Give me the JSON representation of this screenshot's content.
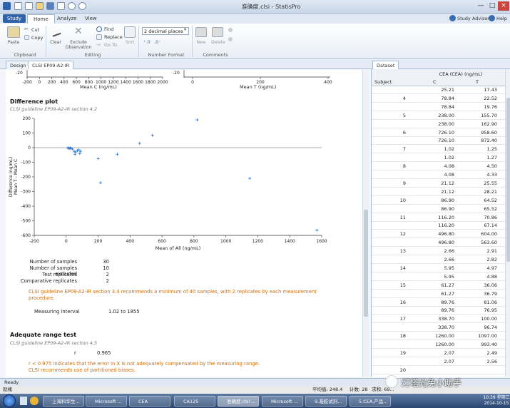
{
  "window": {
    "title": "准确度.clsi - StatisPro"
  },
  "menu": {
    "study": "Study",
    "tabs": [
      "Home",
      "Analyze",
      "View"
    ],
    "right": [
      "Study Advisor",
      "Help"
    ]
  },
  "ribbon": {
    "clipboard": {
      "paste": "Paste",
      "cut": "Cut",
      "copy": "Copy",
      "label": "Clipboard"
    },
    "editing": {
      "clear": "Clear",
      "exclude": "Exclude\nObservation",
      "find": "Find",
      "replace": "Replace",
      "goto": "Go To",
      "sort": "Sort",
      "label": "Editing"
    },
    "number_format": {
      "select": "2 decimal places",
      "label": "Number Format"
    },
    "comments": {
      "new": "New",
      "delete": "Delete",
      "label": "Comments"
    }
  },
  "doc_tabs": [
    "Design",
    "CLSI EP09-A2-IR"
  ],
  "dataset_tab": "Dataset",
  "top_axes": {
    "left": {
      "ticks": [
        "-200",
        "0",
        "200",
        "400",
        "600",
        "800",
        "1000",
        "1200",
        "1400",
        "1600",
        "1800",
        "2000"
      ],
      "xlabel": "Mean C (ng/mL)",
      "ytick": "-20"
    },
    "right": {
      "ticks": [
        "0",
        "200",
        "400"
      ],
      "xlabel": "Mean T (ng/mL)",
      "ytick": "-20"
    }
  },
  "difference_plot": {
    "title": "Difference plot",
    "subtitle": "CLSI guideline EP09-A2-IR section 4.2"
  },
  "chart_data": {
    "type": "scatter",
    "xlabel": "Mean of All (ng/mL)",
    "ylabel": "Difference (ng/mL)\nMean T - Mean C",
    "xlim": [
      -200,
      1600
    ],
    "ylim": [
      -600,
      200
    ],
    "xticks": [
      "-200",
      "0",
      "200",
      "400",
      "600",
      "800",
      "1000",
      "1200",
      "1400",
      "1600"
    ],
    "yticks": [
      "200",
      "100",
      "0",
      "-100",
      "-200",
      "-300",
      "-400",
      "-500",
      "-600"
    ],
    "points": [
      [
        10,
        -2
      ],
      [
        15,
        -3
      ],
      [
        20,
        -5
      ],
      [
        25,
        -2
      ],
      [
        30,
        -4
      ],
      [
        40,
        -10
      ],
      [
        50,
        -25
      ],
      [
        55,
        -45
      ],
      [
        60,
        -30
      ],
      [
        70,
        -20
      ],
      [
        80,
        -15
      ],
      [
        85,
        -40
      ],
      [
        90,
        -25
      ],
      [
        200,
        -75
      ],
      [
        215,
        -240
      ],
      [
        320,
        -45
      ],
      [
        460,
        30
      ],
      [
        540,
        85
      ],
      [
        820,
        190
      ],
      [
        1150,
        -210
      ],
      [
        1570,
        -565
      ]
    ]
  },
  "summary": {
    "rows": [
      {
        "label": "Number of samples",
        "value": "30"
      },
      {
        "label": "Number of samples excluded",
        "value": "10"
      },
      {
        "label": "Test replicates",
        "value": "2"
      },
      {
        "label": "Comparative replicates",
        "value": "2"
      }
    ],
    "warning": "CLSI guideline EP09-A2-IR section 3.4 recommends a minimum of 40 samples, with 2 replicates by each measurement procedure.",
    "interval_label": "Measuring interval",
    "interval_value": "1.02 to 1855"
  },
  "adequate": {
    "title": "Adequate range test",
    "subtitle": "CLSI guideline EP09-A2-IR section 4.5",
    "r_label": "r",
    "r_value": "0.965",
    "note1": "r < 0.975 indicates that the error in X is not adequately compensated by the measuring range.",
    "note2": "CLSI recommends use of partitioned biases."
  },
  "dataset": {
    "header": "CEA (CEA) (ng/mL)",
    "col_subject": "Subject",
    "col_c": "C",
    "col_t": "T",
    "rows": [
      {
        "s": "",
        "c": "25.21",
        "t": "17.43"
      },
      {
        "s": "4",
        "c": "78.84",
        "t": "22.52"
      },
      {
        "s": "",
        "c": "78.84",
        "t": "19.76"
      },
      {
        "s": "5",
        "c": "238.00",
        "t": "155.70"
      },
      {
        "s": "",
        "c": "238.00",
        "t": "162.90"
      },
      {
        "s": "6",
        "c": "726.10",
        "t": "958.60"
      },
      {
        "s": "",
        "c": "726.10",
        "t": "872.40"
      },
      {
        "s": "7",
        "c": "1.02",
        "t": "1.25"
      },
      {
        "s": "",
        "c": "1.02",
        "t": "1.27"
      },
      {
        "s": "8",
        "c": "4.08",
        "t": "4.50"
      },
      {
        "s": "",
        "c": "4.08",
        "t": "4.33"
      },
      {
        "s": "9",
        "c": "21.12",
        "t": "25.55"
      },
      {
        "s": "",
        "c": "21.12",
        "t": "28.21"
      },
      {
        "s": "10",
        "c": "86.90",
        "t": "64.52"
      },
      {
        "s": "",
        "c": "86.90",
        "t": "65.52"
      },
      {
        "s": "11",
        "c": "116.20",
        "t": "70.86"
      },
      {
        "s": "",
        "c": "116.20",
        "t": "67.14"
      },
      {
        "s": "12",
        "c": "496.80",
        "t": "604.00"
      },
      {
        "s": "",
        "c": "496.80",
        "t": "563.60"
      },
      {
        "s": "13",
        "c": "2.66",
        "t": "2.91"
      },
      {
        "s": "",
        "c": "2.66",
        "t": "2.82"
      },
      {
        "s": "14",
        "c": "5.95",
        "t": "4.97"
      },
      {
        "s": "",
        "c": "5.95",
        "t": "4.88"
      },
      {
        "s": "15",
        "c": "61.27",
        "t": "36.06"
      },
      {
        "s": "",
        "c": "61.27",
        "t": "36.79"
      },
      {
        "s": "16",
        "c": "89.76",
        "t": "81.06"
      },
      {
        "s": "",
        "c": "89.76",
        "t": "76.95"
      },
      {
        "s": "17",
        "c": "338.70",
        "t": "100.00"
      },
      {
        "s": "",
        "c": "338.70",
        "t": "96.74"
      },
      {
        "s": "18",
        "c": "1260.00",
        "t": "1097.00"
      },
      {
        "s": "",
        "c": "1260.00",
        "t": "993.40"
      },
      {
        "s": "19",
        "c": "2.07",
        "t": "2.49"
      },
      {
        "s": "",
        "c": "2.07",
        "t": "2.56"
      },
      {
        "s": "20",
        "c": "",
        "t": ""
      }
    ]
  },
  "status": {
    "ready": "Ready",
    "left": "就绪",
    "avg": "平均值: 248.4",
    "count": "计数: 28",
    "sum": "求和: 69..."
  },
  "taskbar": {
    "items": [
      "上海科华生...",
      "Microsoft ...",
      "CEA",
      "CA125",
      "准确度.clsi ...",
      "Microsoft ...",
      "9.凝胶试剂...",
      "5.CEA.产品..."
    ],
    "time": "10:39 星期三",
    "date": "2014-10-15"
  },
  "watermark": "灯塔光免小助手"
}
